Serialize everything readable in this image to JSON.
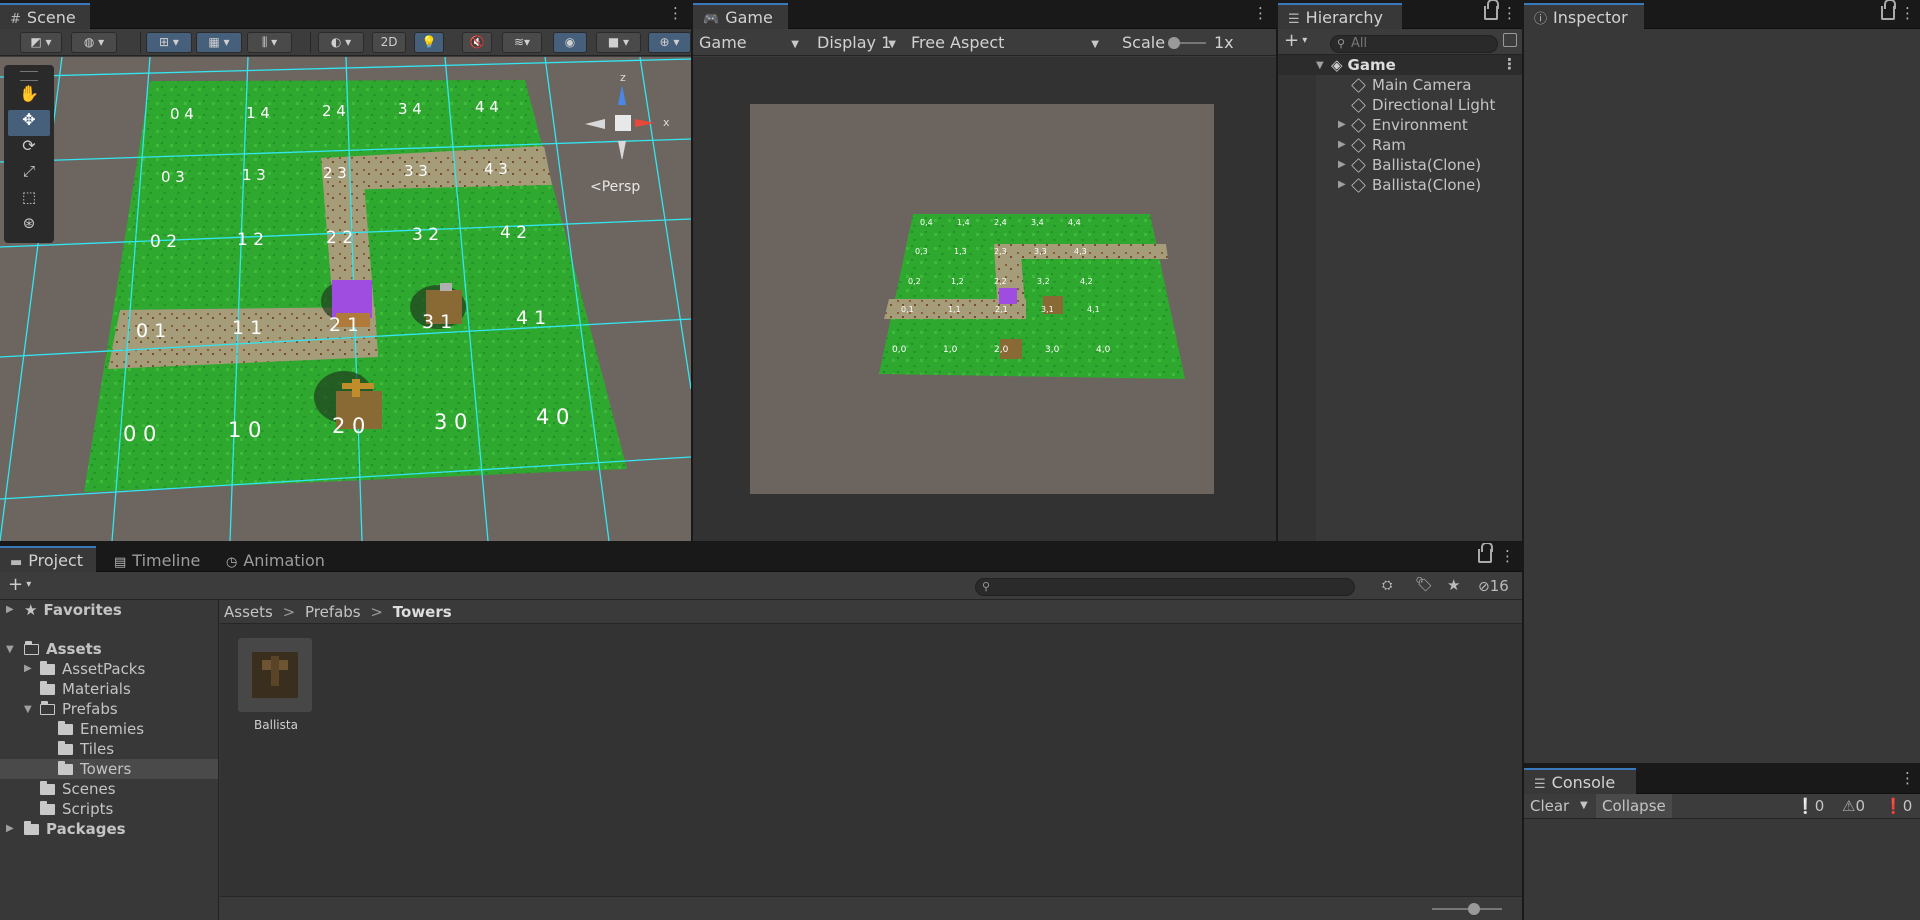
{
  "scene": {
    "tab": "Scene",
    "toolbar": {
      "btn2d": "2D"
    },
    "persp": "Persp",
    "gizmo_axes": {
      "x": "x",
      "z": "z"
    },
    "tile_labels": [
      "0 4",
      "1 4",
      "2 4",
      "3 4",
      "4 4",
      "0 3",
      "1 3",
      "2 3",
      "3 3",
      "4 3",
      "0 2",
      "1 2",
      "2 2",
      "3 2",
      "4 2",
      "0 1",
      "1 1",
      "2 1",
      "3 1",
      "4 1",
      "0 0",
      "1 0",
      "2 0",
      "3 0",
      "4 0"
    ]
  },
  "game": {
    "tab": "Game",
    "display_mode": "Game",
    "display": "Display 1",
    "aspect": "Free Aspect",
    "scale_label": "Scale",
    "scale_value": "1x",
    "tile_labels": [
      "0,4",
      "1,4",
      "2,4",
      "3,4",
      "4,4",
      "0,3",
      "1,3",
      "2,3",
      "3,3",
      "4,3",
      "0,2",
      "1,2",
      "2,2",
      "3,2",
      "4,2",
      "0,1",
      "1,1",
      "2,1",
      "3,1",
      "4,1",
      "0,0",
      "1,0",
      "2,0",
      "3,0",
      "4,0"
    ]
  },
  "hierarchy": {
    "tab": "Hierarchy",
    "search_placeholder": "All",
    "root": "Game",
    "items": [
      "Main Camera",
      "Directional Light",
      "Environment",
      "Ram",
      "Ballista(Clone)",
      "Ballista(Clone)"
    ]
  },
  "inspector": {
    "tab": "Inspector"
  },
  "project": {
    "tabs": [
      "Project",
      "Timeline",
      "Animation"
    ],
    "hidden_count": "16",
    "tree": {
      "favorites": "Favorites",
      "assets": "Assets",
      "assetpacks": "AssetPacks",
      "materials": "Materials",
      "prefabs": "Prefabs",
      "enemies": "Enemies",
      "tiles": "Tiles",
      "towers": "Towers",
      "scenes": "Scenes",
      "scripts": "Scripts",
      "packages": "Packages"
    },
    "breadcrumb": [
      "Assets",
      "Prefabs",
      "Towers"
    ],
    "assets": [
      {
        "name": "Ballista"
      }
    ]
  },
  "console": {
    "tab": "Console",
    "clear": "Clear",
    "collapse": "Collapse",
    "counts": {
      "info": "0",
      "warn": "0",
      "error": "0"
    }
  },
  "colors": {
    "accent": "#3a79bb",
    "grass": "#2fa82f",
    "path": "#a39a78",
    "gridline": "#32e6f2",
    "ram": "#9f4de0"
  }
}
